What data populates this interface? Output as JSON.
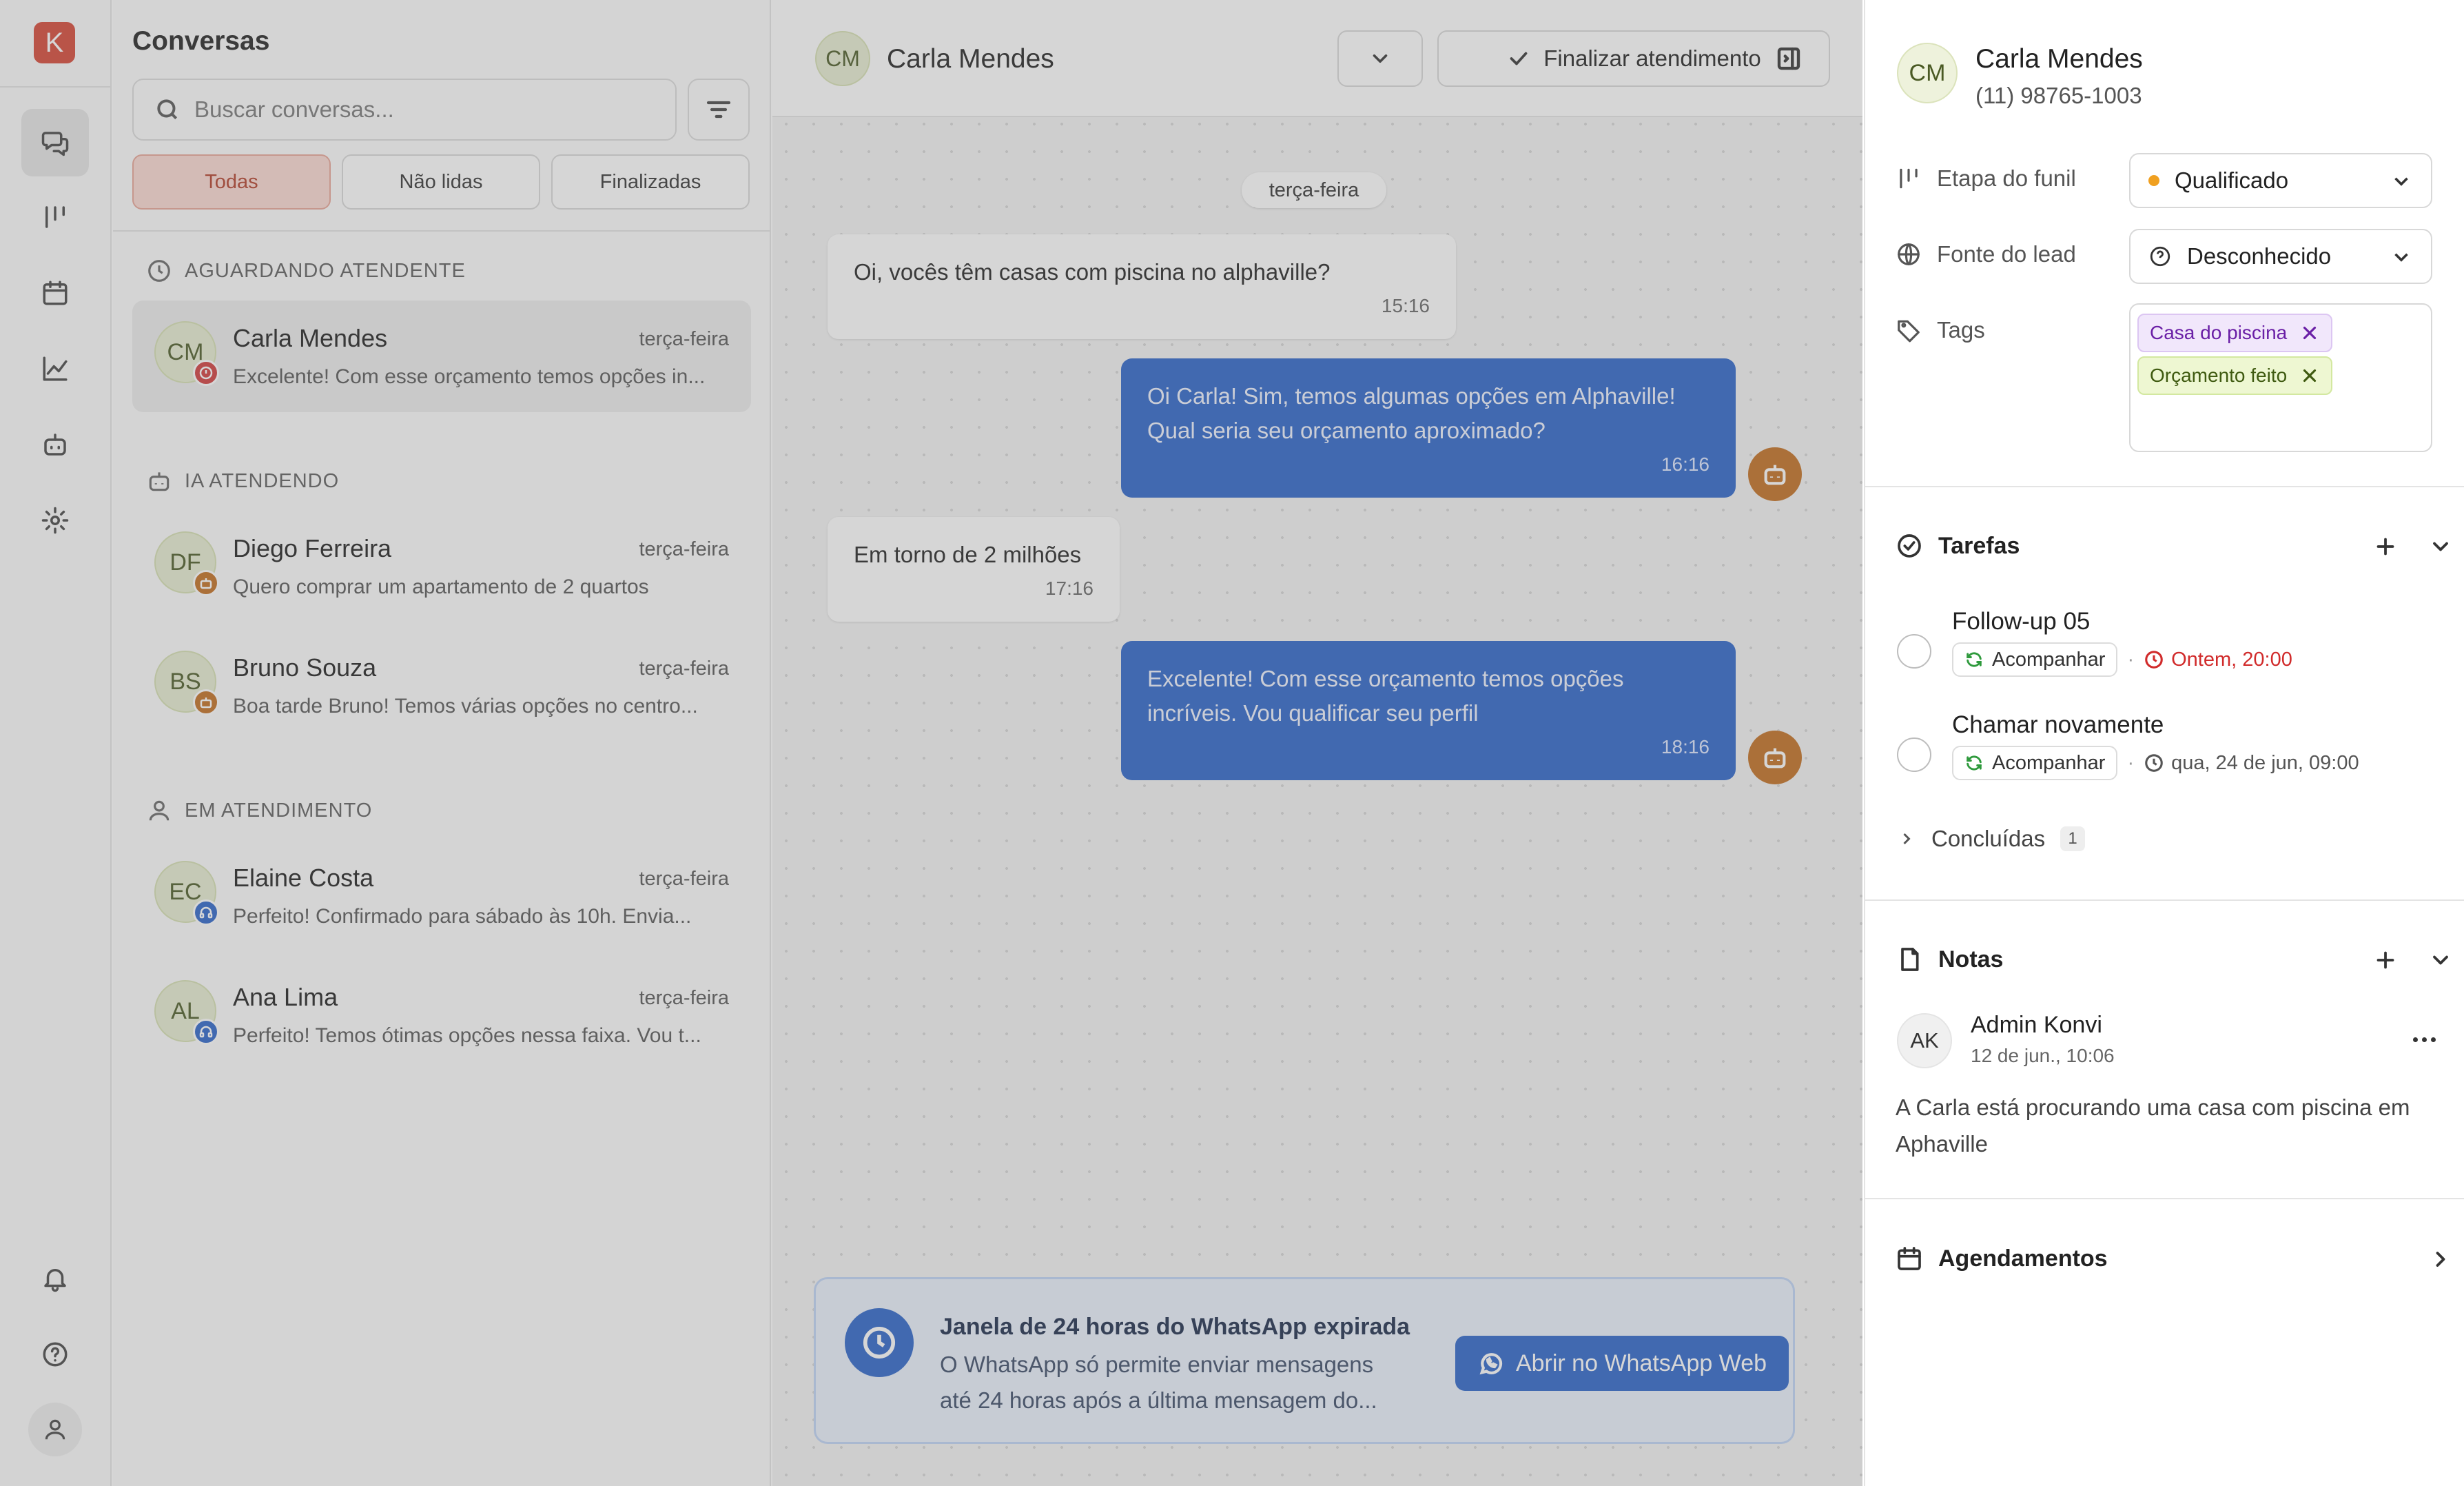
{
  "rail": {
    "logo_letter": "K",
    "icons": [
      "chat-icon",
      "pipeline-icon",
      "calendar-icon",
      "chart-icon",
      "bot-icon",
      "gear-icon",
      "bell-icon",
      "help-icon",
      "user-icon"
    ]
  },
  "conversations": {
    "title": "Conversas",
    "search_placeholder": "Buscar conversas...",
    "tabs": [
      {
        "label": "Todas",
        "active": true
      },
      {
        "label": "Não lidas",
        "active": false
      },
      {
        "label": "Finalizadas",
        "active": false
      }
    ],
    "sections": [
      {
        "title": "AGUARDANDO ATENDENTE",
        "items": [
          {
            "initials": "CM",
            "name": "Carla Mendes",
            "time": "terça-feira",
            "preview": "Excelente! Com esse orçamento temos opções in...",
            "badge_color": "#d13b3b",
            "badge_icon": "alert-icon"
          }
        ]
      },
      {
        "title": "IA ATENDENDO",
        "items": [
          {
            "initials": "DF",
            "name": "Diego Ferreira",
            "time": "terça-feira",
            "preview": "Quero comprar um apartamento de 2 quartos",
            "badge_color": "#c26d1f",
            "badge_icon": "bot-icon"
          },
          {
            "initials": "BS",
            "name": "Bruno Souza",
            "time": "terça-feira",
            "preview": "Boa tarde Bruno! Temos várias opções no centro...",
            "badge_color": "#c26d1f",
            "badge_icon": "bot-icon"
          }
        ]
      },
      {
        "title": "EM ATENDIMENTO",
        "items": [
          {
            "initials": "EC",
            "name": "Elaine Costa",
            "time": "terça-feira",
            "preview": "Perfeito! Confirmado para sábado às 10h. Envia...",
            "badge_color": "#2a63c9",
            "badge_icon": "headset-icon"
          },
          {
            "initials": "AL",
            "name": "Ana Lima",
            "time": "terça-feira",
            "preview": "Perfeito! Temos ótimas opções nessa faixa. Vou t...",
            "badge_color": "#2a63c9",
            "badge_icon": "headset-icon"
          }
        ]
      }
    ]
  },
  "chat": {
    "contact_initials": "CM",
    "contact_name": "Carla Mendes",
    "finish_label": "Finalizar atendimento",
    "day_label": "terça-feira",
    "messages": [
      {
        "dir": "in",
        "text": "Oi, vocês têm casas com piscina no alphaville?",
        "time": "15:16"
      },
      {
        "dir": "out",
        "text": "Oi Carla! Sim, temos algumas opções em Alphaville! Qual seria seu orçamento aproximado?",
        "time": "16:16"
      },
      {
        "dir": "in",
        "text": "Em torno de 2 milhões",
        "time": "17:16"
      },
      {
        "dir": "out",
        "text": "Excelente! Com esse orçamento temos opções incríveis. Vou qualificar seu perfil",
        "time": "18:16"
      }
    ],
    "banner": {
      "title": "Janela de 24 horas do WhatsApp expirada",
      "desc": "O WhatsApp só permite enviar mensagens até 24 horas após a última mensagem do...",
      "button_label": "Abrir no WhatsApp Web"
    }
  },
  "contact": {
    "initials": "CM",
    "name": "Carla Mendes",
    "phone": "(11) 98765-1003",
    "funnel_label": "Etapa do funil",
    "funnel_value": "Qualificado",
    "funnel_color": "#f0a020",
    "source_label": "Fonte do lead",
    "source_value": "Desconhecido",
    "tags_label": "Tags",
    "tags": [
      {
        "label": "Casa do piscina",
        "color": "purple"
      },
      {
        "label": "Orçamento feito",
        "color": "green"
      }
    ]
  },
  "tasks": {
    "title": "Tarefas",
    "items": [
      {
        "name": "Follow-up 05",
        "action": "Acompanhar",
        "due": "Ontem, 20:00",
        "overdue": true
      },
      {
        "name": "Chamar novamente",
        "action": "Acompanhar",
        "due": "qua, 24 de jun, 09:00",
        "overdue": false
      }
    ],
    "done_label": "Concluídas",
    "done_count": "1"
  },
  "notes": {
    "title": "Notas",
    "author_initials": "AK",
    "author": "Admin Konvi",
    "date": "12 de jun., 10:06",
    "body": "A Carla está procurando uma casa com piscina em Aphaville"
  },
  "appointments": {
    "title": "Agendamentos"
  }
}
